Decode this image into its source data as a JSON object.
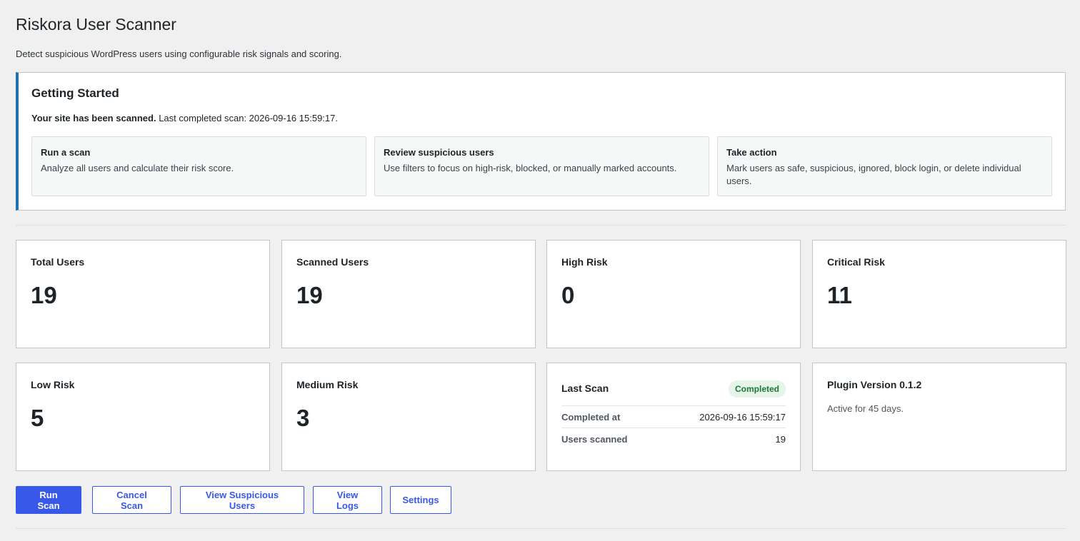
{
  "header": {
    "title": "Riskora User Scanner",
    "description": "Detect suspicious WordPress users using configurable risk signals and scoring."
  },
  "getting_started": {
    "title": "Getting Started",
    "status_bold": "Your site has been scanned.",
    "status_rest": " Last completed scan: 2026-09-16 15:59:17.",
    "steps": [
      {
        "title": "Run a scan",
        "text": "Analyze all users and calculate their risk score."
      },
      {
        "title": "Review suspicious users",
        "text": "Use filters to focus on high-risk, blocked, or manually marked accounts."
      },
      {
        "title": "Take action",
        "text": "Mark users as safe, suspicious, ignored, block login, or delete individual users."
      }
    ]
  },
  "stats": [
    {
      "label": "Total Users",
      "value": "19"
    },
    {
      "label": "Scanned Users",
      "value": "19"
    },
    {
      "label": "High Risk",
      "value": "0"
    },
    {
      "label": "Critical Risk",
      "value": "11"
    },
    {
      "label": "Low Risk",
      "value": "5"
    },
    {
      "label": "Medium Risk",
      "value": "3"
    }
  ],
  "last_scan": {
    "title": "Last Scan",
    "status": "Completed",
    "rows": [
      {
        "key": "Completed at",
        "value": "2026-09-16 15:59:17"
      },
      {
        "key": "Users scanned",
        "value": "19"
      }
    ]
  },
  "plugin": {
    "title": "Plugin Version 0.1.2",
    "text": "Active for 45 days."
  },
  "actions": {
    "run_scan": "Run Scan",
    "cancel_scan": "Cancel Scan",
    "view_suspicious": "View Suspicious Users",
    "view_logs": "View Logs",
    "settings": "Settings"
  },
  "colors": {
    "accent": "#3858e9",
    "notice_border": "#2271b1",
    "badge_bg": "#e6f4ea",
    "badge_text": "#1a7a34"
  }
}
